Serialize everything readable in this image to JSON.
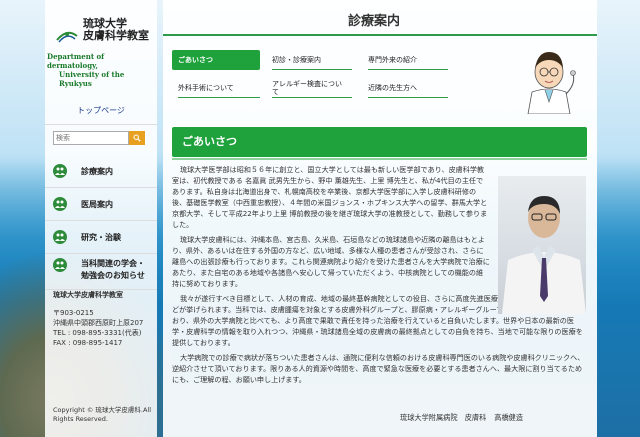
{
  "sidebar": {
    "logo_name_line1": "琉球大学",
    "logo_name_line2": "皮膚科学教室",
    "logo_en_line1": "Department of dermatology,",
    "logo_en_line2": "University of the Ryukyus",
    "top_link": "トップページ",
    "search_placeholder": "検索",
    "nav": [
      {
        "label": "診療案内",
        "icon": "people-icon"
      },
      {
        "label": "医局案内",
        "icon": "people-icon"
      },
      {
        "label": "研究・治験",
        "icon": "people-icon"
      },
      {
        "label_line1": "当科関連の学会・",
        "label_line2": "勉強会のお知らせ",
        "icon": "people-icon"
      }
    ],
    "address": {
      "org": "琉球大学皮膚科学教室",
      "postal": "〒903-0215",
      "addr": "沖縄県中頭郡西原町上原207",
      "tel": "TEL : 098-895-3331(代表)",
      "fax": "FAX : 098-895-1417"
    },
    "copyright_line1": "Copyright ©  琉球大学皮膚科.All",
    "copyright_line2": "Rights Reserved."
  },
  "header": {
    "title": "診療案内"
  },
  "tabs": [
    {
      "label": "ごあいさつ"
    },
    {
      "label": "初診・診療案内"
    },
    {
      "label": "専門外来の紹介"
    },
    {
      "label": "外科手術について"
    },
    {
      "label_line1": "アレルギー検査につい",
      "label_line2": "て"
    },
    {
      "label": "近隣の先生方へ"
    }
  ],
  "section": {
    "title": "ごあいさつ"
  },
  "body": {
    "p1": "琉球大学医学部は昭和５６年に創立と、国立大学としては最も新しい医学部であり、皮膚科学教室は、初代教授である 名嘉眞 武男先生から、野中 薫雄先生、上里 博先生と、私が4代目の主任であります。私自身は北海道出身で、札幌南高校を卒業後、京都大学医学部に入学し皮膚科研修の後、基礎医学教室（中西重忠教授）、４年間の米国ジョンス・ホプキンス大学への留学、群馬大学と京都大学、そして平成22年より上里 博前教授の後を継ぎ琉球大学の准教授として、勤務して参りました。",
    "p2": "琉球大学皮膚科には、沖縄本島、宮古島、久米島、石垣島などの琉球諸島や近隣の離島はもとより、県外、あるいは在住する外国の方など、広い地域、多様な人種の患者さんが受診され、さらに離島への出張診療も行っております。これら関連病院より紹介を受けた患者さんを大学病院で治療にあたり、また自宅のある地域や各諸島へ安心して帰っていただくよう、中核病院としての機能の維持に努めております。",
    "p3": "我々が遂行すべき目標として、人材の育成、地域の最終基幹病院としての役目、さらに高度先進医療施設としてのチャレンジなどが挙げられます。当科では、皮膚腫瘍を対象とする皮膚外科グループと、膠原病・アレルギーグループがうまく融合し機能しており、県外の大学病院と比べても、より高度で果敢で責任を持った治療を行えていると自負いたします。世界や日本の最新の医学・皮膚科学の情報を取り入れつつ、沖縄県・琉球諸島全域の皮膚病の最終拠点としての自負を持ち、当地で可能な限りの医療を提供しております。",
    "p4": "大学病院での診療で病状が落ちついた患者さんは、通院に便利な信頼のおける皮膚科専門医のいる病院や皮膚科クリニックへ、逆紹介させて頂いております。限りある人的資源や時間を、高度で緊急な医療を必要とする患者さんへ、最大限に割り当てるためにも、ご理解の程、お願い申し上げます。",
    "sig_org": "琉球大学附属病院　皮膚科",
    "sig_name": "高橋健造"
  },
  "colors": {
    "accent": "#1fa23c",
    "search_button": "#e8a020",
    "link": "#1a3a8a"
  }
}
